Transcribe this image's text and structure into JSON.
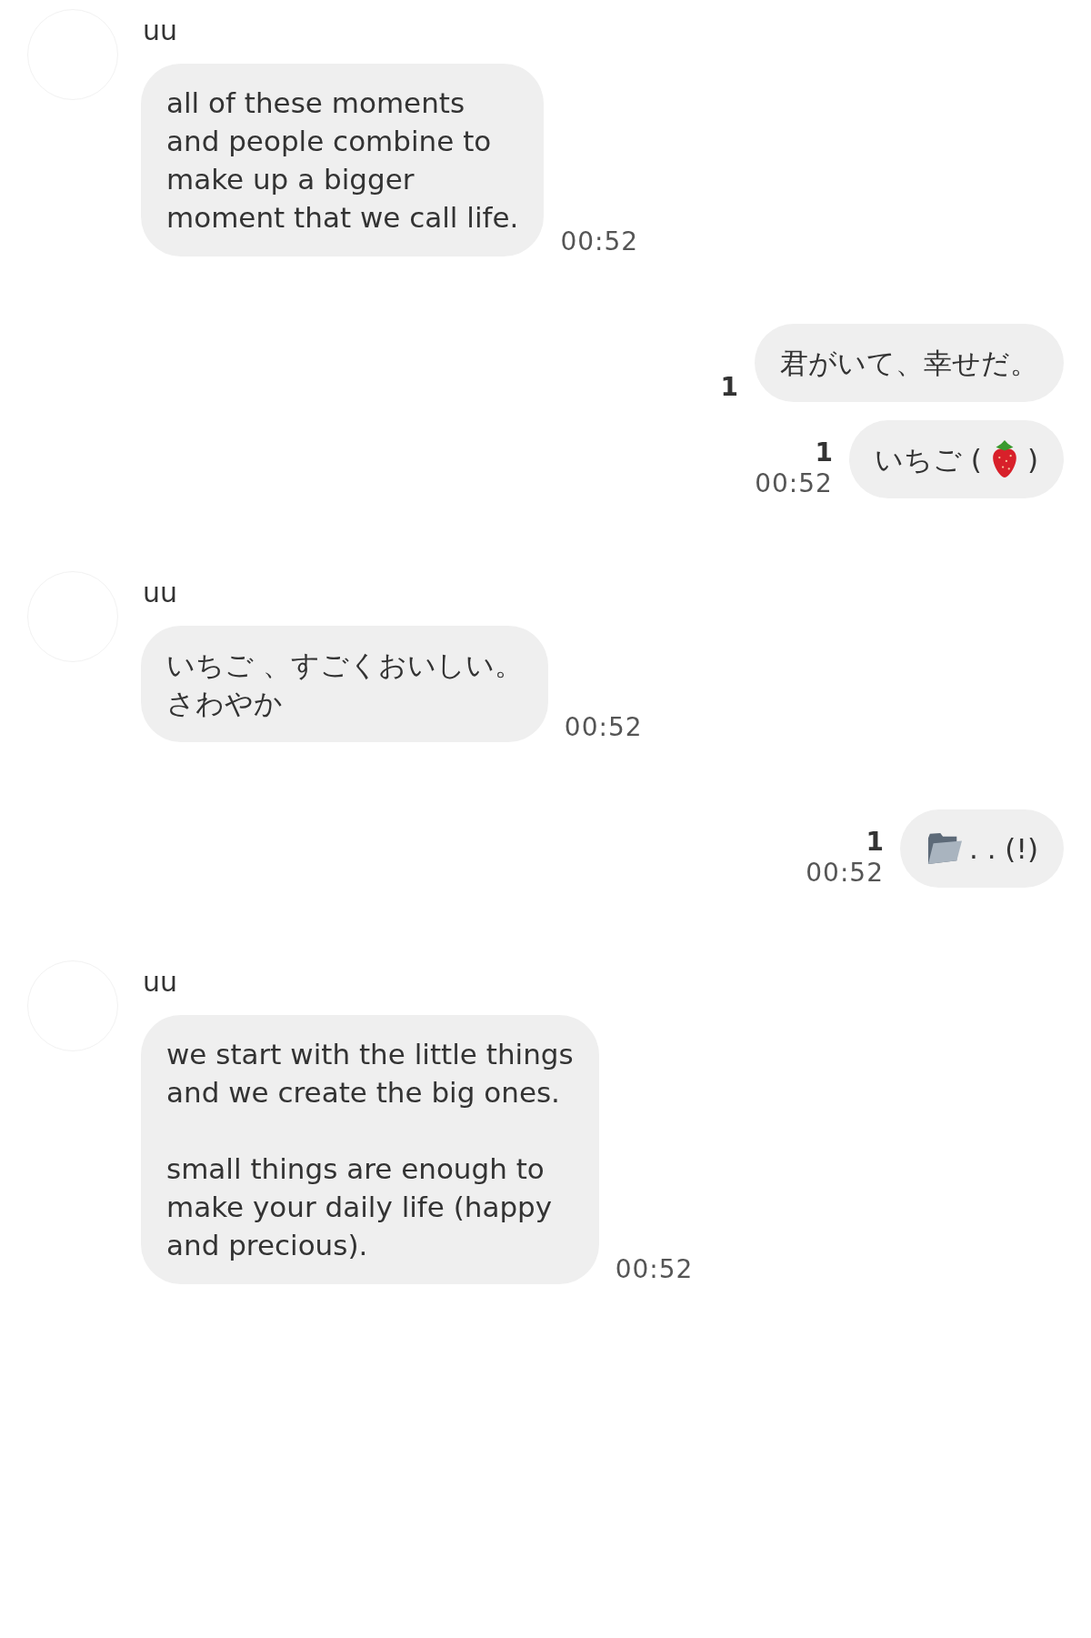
{
  "messages": [
    {
      "kind": "incoming",
      "sender": "uu",
      "bubbles": [
        {
          "text": "all of these moments\nand people combine to\nmake up a bigger\nmoment that we call life.",
          "time": "00:52"
        }
      ]
    },
    {
      "kind": "outgoing",
      "bubbles": [
        {
          "text": "君がいて、幸せだ。",
          "read": "1"
        },
        {
          "kind": "with_emoji",
          "text": "いちご (",
          "text_after": ")",
          "read": "1",
          "time": "00:52"
        }
      ]
    },
    {
      "kind": "incoming",
      "sender": "uu",
      "bubbles": [
        {
          "lines": [
            "いちご 、すごくおいしい。",
            "さわやか"
          ],
          "time": "00:52"
        }
      ]
    },
    {
      "kind": "outgoing",
      "bubbles": [
        {
          "kind": "with_emoji",
          "text_after": ". . (!)",
          "read": "1",
          "time": "00:52"
        }
      ]
    },
    {
      "kind": "incoming",
      "sender": "uu",
      "bubbles": [
        {
          "text": "we start with the little things\nand we create the big ones.\n\nsmall things are enough to\nmake your daily life (happy\nand precious).",
          "time": "00:52"
        }
      ]
    }
  ]
}
